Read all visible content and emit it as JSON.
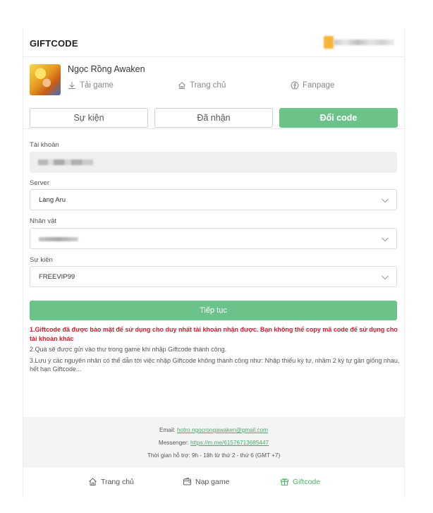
{
  "header": {
    "title": "GIFTCODE"
  },
  "game": {
    "name": "Ngọc Rồng Awaken",
    "links": {
      "download": "Tải game",
      "home": "Trang chủ",
      "fanpage": "Fanpage"
    }
  },
  "tabs": [
    {
      "label": "Sự kiện",
      "active": false
    },
    {
      "label": "Đã nhận",
      "active": false
    },
    {
      "label": "Đổi code",
      "active": true
    }
  ],
  "form": {
    "account_label": "Tài khoản",
    "server_label": "Server",
    "server_value": "Làng Aru",
    "character_label": "Nhân vật",
    "event_label": "Sự kiện",
    "event_value": "FREEVIP99"
  },
  "submit_label": "Tiếp tục",
  "notes": {
    "red": "1.Giftcode đã được bảo mật để sử dụng cho duy nhất tài khoản nhận được. Bạn không thể copy mã code để sử dụng cho tài khoản khác",
    "line2": "2.Quà sẽ được gửi vào thư trong game khi nhập Giftcode thành công.",
    "line3": "3.Lưu ý các nguyên nhân có thể dẫn tới việc nhập Giftcode không thành công như: Nhập thiếu ký tự, nhầm 2 ký tự gần giống nhau, hết hạn Giftcode..."
  },
  "footer": {
    "email_label": "Email:",
    "email": "hotro.ngocrongawaken@gmail.com",
    "messenger_label": "Messenger:",
    "messenger": "https://m.me/61576713685447",
    "hours": "Thời gian hỗ trợ: 9h - 18h từ thứ 2 - thứ 6 (GMT +7)"
  },
  "bottom_nav": [
    {
      "label": "Trang chủ",
      "icon": "home-icon",
      "active": false
    },
    {
      "label": "Nạp game",
      "icon": "wallet-icon",
      "active": false
    },
    {
      "label": "Giftcode",
      "icon": "gift-icon",
      "active": true
    }
  ],
  "colors": {
    "accent": "#6cc38a",
    "warning": "#e0162b",
    "link": "#4aa86b"
  }
}
